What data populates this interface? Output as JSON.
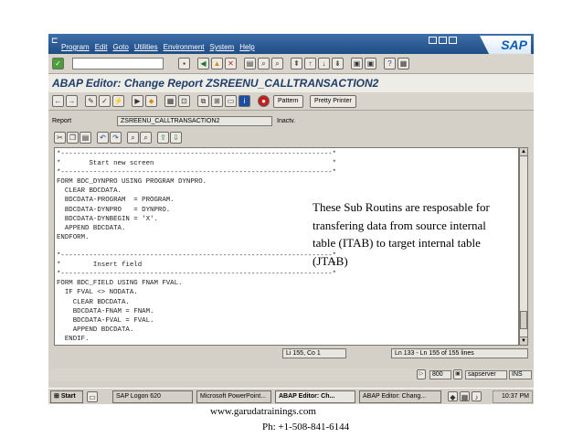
{
  "menubar": {
    "items": [
      "Program",
      "Edit",
      "Goto",
      "Utilities",
      "Environment",
      "System",
      "Help"
    ],
    "logo": "SAP"
  },
  "title": "ABAP Editor: Change Report ZSREENU_CALLTRANSACTION2",
  "app_toolbar": {
    "pattern_label": "Pattern",
    "pretty_printer_label": "Pretty Printer"
  },
  "report": {
    "label": "Report",
    "name": "ZSREENU_CALLTRANSACTION2",
    "status": "Inactv."
  },
  "code_lines": [
    "*-------------------------------------------------------------------*",
    "*       Start new screen                                            *",
    "*-------------------------------------------------------------------*",
    "FORM BDC_DYNPRO USING PROGRAM DYNPRO.",
    "  CLEAR BDCDATA.",
    "  BDCDATA-PROGRAM  = PROGRAM.",
    "  BDCDATA-DYNPRO   = DYNPRO.",
    "  BDCDATA-DYNBEGIN = 'X'.",
    "  APPEND BDCDATA.",
    "ENDFORM.",
    "",
    "*-------------------------------------------------------------------*",
    "*        Insert field                                               *",
    "*-------------------------------------------------------------------*",
    "FORM BDC_FIELD USING FNAM FVAL.",
    "  IF FVAL <> NODATA.",
    "    CLEAR BDCDATA.",
    "    BDCDATA-FNAM = FNAM.",
    "    BDCDATA-FVAL = FVAL.",
    "    APPEND BDCDATA.",
    "  ENDIF.",
    "ENDFORM."
  ],
  "annotation": "These Sub Routins are resposable for transfering data from source internal table (ITAB) to target internal table (JTAB)",
  "position": {
    "cursor": "Li 155, Co 1",
    "lines": "Ln 133 - Ln 155 of 155 lines"
  },
  "status": {
    "client": "800",
    "server": "sapserver",
    "mode": "INS"
  },
  "taskbar": {
    "start": "Start",
    "tasks": [
      "SAP Logon 620",
      "Microsoft PowerPoint...",
      "ABAP Editor: Ch...",
      "ABAP Editor: Chang..."
    ],
    "clock": "10:37 PM"
  },
  "footer": {
    "website": "www.garudatrainings.com",
    "phone": "Ph: +1-508-841-6144"
  }
}
